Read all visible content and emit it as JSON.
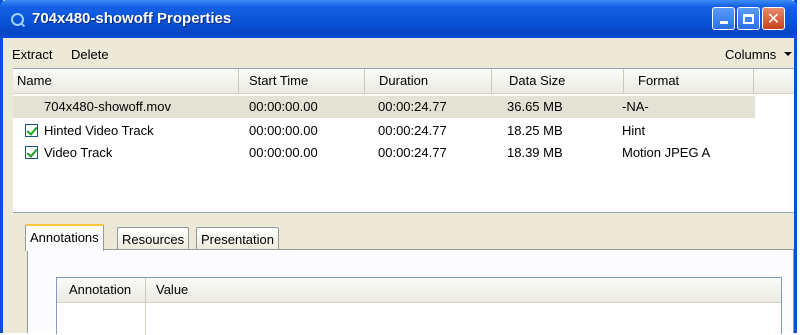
{
  "window": {
    "title": "704x480-showoff Properties",
    "accent_color": "#0a4fd8",
    "controls": [
      "minimize-icon",
      "maximize-icon",
      "close-icon"
    ]
  },
  "toolbar": {
    "extract_label": "Extract",
    "delete_label": "Delete",
    "columns_label": "Columns"
  },
  "tracks": {
    "columns": [
      "Name",
      "Start Time",
      "Duration",
      "Data Size",
      "Format"
    ],
    "rows": [
      {
        "name": "704x480-showoff.mov",
        "start": "00:00:00.00",
        "duration": "00:00:24.77",
        "size": "36.65 MB",
        "format": "-NA-",
        "checkbox": false,
        "selected": true
      },
      {
        "name": "Hinted Video Track",
        "start": "00:00:00.00",
        "duration": "00:00:24.77",
        "size": "18.25 MB",
        "format": "Hint",
        "checkbox": true,
        "checked": true
      },
      {
        "name": "Video Track",
        "start": "00:00:00.00",
        "duration": "00:00:24.77",
        "size": "18.39 MB",
        "format": "Motion JPEG A",
        "checkbox": true,
        "checked": true
      }
    ]
  },
  "tabs": {
    "items": [
      "Annotations",
      "Resources",
      "Presentation"
    ],
    "active": "Annotations"
  },
  "annotations": {
    "columns": [
      "Annotation",
      "Value"
    ]
  }
}
